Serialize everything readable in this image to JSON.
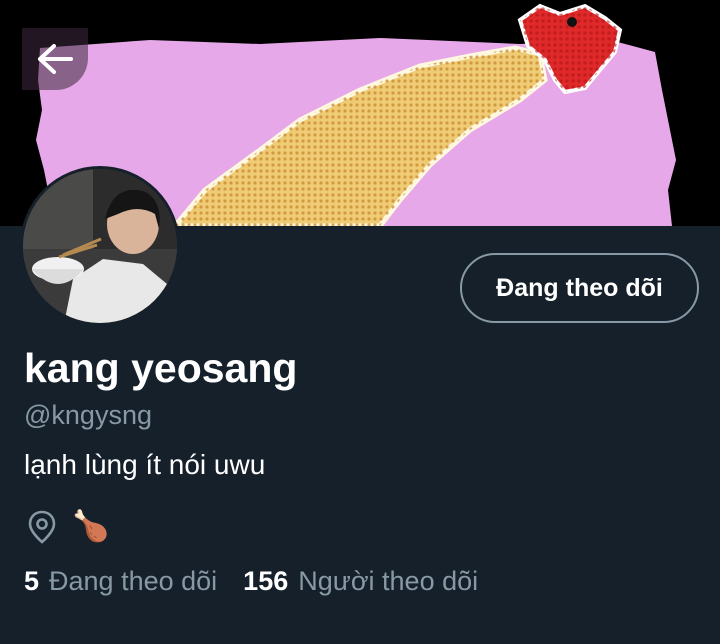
{
  "header": {
    "back_icon": "arrow-left-icon",
    "banner_colors": {
      "background": "#000000",
      "paper": "#e6a8e8",
      "chicken_body": "#e9c66a",
      "chicken_comb": "#e0292a"
    }
  },
  "profile": {
    "display_name": "kang yeosang",
    "handle": "@kngysng",
    "bio": "lạnh lùng ít nói uwu",
    "location_icon": "location-pin-icon",
    "location_text": "🍗",
    "follow_button_label": "Đang theo dõi",
    "following_count": "5",
    "following_label": "Đang theo dõi",
    "followers_count": "156",
    "followers_label": "Người theo dõi"
  },
  "theme": {
    "background": "#15202b",
    "muted_text": "#8899a6",
    "border": "#8899a6"
  }
}
